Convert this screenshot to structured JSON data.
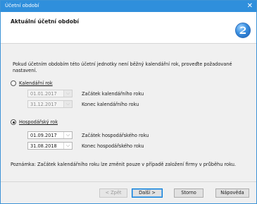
{
  "window": {
    "title": "Účetní období",
    "close": "✕"
  },
  "header": {
    "title": "Aktuální účetní období"
  },
  "description": "Pokud účetním obdobím této účetní jednotky není běžný kalendářní rok, proveďte požadované nastavení.",
  "calendar_year": {
    "label": "Kalendářní rok",
    "selected": false,
    "start_value": "01.01.2017",
    "start_label": "Začátek kalendářního roku",
    "end_value": "31.12.2017",
    "end_label": "Konec kalendářního roku"
  },
  "fiscal_year": {
    "label": "Hospodářský rok",
    "selected": true,
    "start_value": "01.09.2017",
    "start_label": "Začátek hospodářského roku",
    "end_value": "31.08.2018",
    "end_label": "Konec hospodářského roku"
  },
  "note": "Poznámka: Začátek kalendářního roku lze změnit pouze v případě založení firmy v průběhu roku.",
  "buttons": {
    "back": "< Zpět",
    "next": "Další >",
    "cancel": "Storno",
    "help": "Nápověda"
  },
  "dropdown_glyph": "⌵",
  "colors": {
    "titlebar": "#2f8fdc",
    "accent": "#0078d7"
  }
}
